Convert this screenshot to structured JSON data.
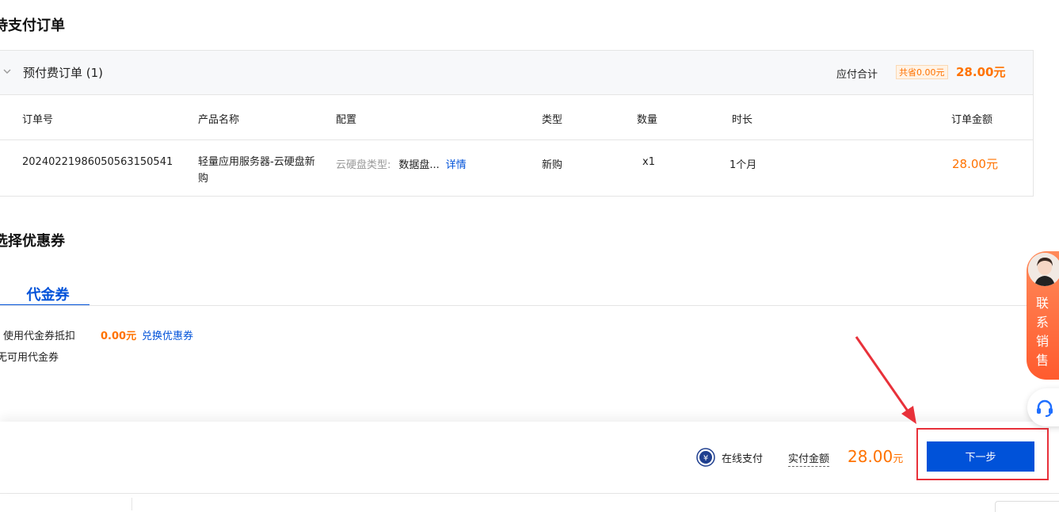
{
  "sections": {
    "pending_orders_title": "待支付订单",
    "coupon_title": "选择优惠券"
  },
  "order_group": {
    "label": "预付费订单 (1)",
    "payable_label": "应付合计",
    "saving_badge": "共省0.00元",
    "total": "28.00元"
  },
  "table": {
    "headers": {
      "order_no": "订单号",
      "product": "产品名称",
      "config": "配置",
      "type": "类型",
      "quantity": "数量",
      "duration": "时长",
      "amount": "订单金额"
    },
    "rows": [
      {
        "order_no": "20240221986050563150541",
        "product": "轻量应用服务器-云硬盘新购",
        "config_key": "云硬盘类型:",
        "config_value": "数据盘...",
        "details_link": "详情",
        "type": "新购",
        "quantity": "x1",
        "duration": "1个月",
        "amount": "28.00元"
      }
    ]
  },
  "coupon": {
    "tab_label": "代金券",
    "use_label": "使用代金券抵扣",
    "use_amount": "0.00元",
    "redeem_link": "兑换优惠券",
    "available_text": "无可用代金券"
  },
  "bottom_bar": {
    "pay_method": "在线支付",
    "paid_label": "实付金额",
    "paid_total": "28.00",
    "paid_unit": "元",
    "next_button": "下一步"
  },
  "side_widgets": {
    "sales_label": "联系销售"
  },
  "colors": {
    "accent_blue": "#0052d9",
    "price_orange": "#ff7200",
    "annotation_red": "#e8313a"
  }
}
